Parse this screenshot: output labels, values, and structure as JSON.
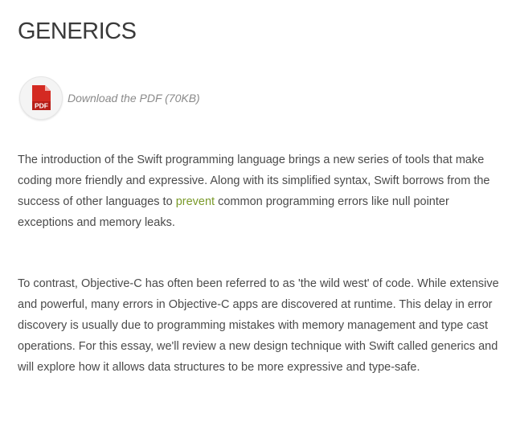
{
  "article": {
    "title": "GENERICS",
    "download": {
      "icon": "pdf-file-icon",
      "icon_label": "PDF",
      "link_text": "Download the PDF (70KB)"
    },
    "paragraph_1": {
      "before_link": "The introduction of the Swift programming language brings a new series of tools that make coding more friendly and expressive. Along with its simplified syntax, Swift borrows from the success of other languages to ",
      "link_text": "prevent",
      "after_link": " common programming errors like null pointer exceptions and memory leaks."
    },
    "paragraph_2": "To contrast, Objective-C has often been referred to as 'the wild west' of code. While extensive and powerful, many errors in Objective-C apps are discovered at runtime. This delay in error discovery is usually due to programming mistakes with memory management and type cast operations. For this essay, we'll review a new design technique with Swift called generics and will explore how it allows data structures to be more expressive and type-safe."
  },
  "colors": {
    "text": "#4a4a4a",
    "title": "#3a3a3a",
    "link": "#7a9a2a",
    "muted_link": "#8a8a8a",
    "pdf_red": "#d42a22"
  }
}
